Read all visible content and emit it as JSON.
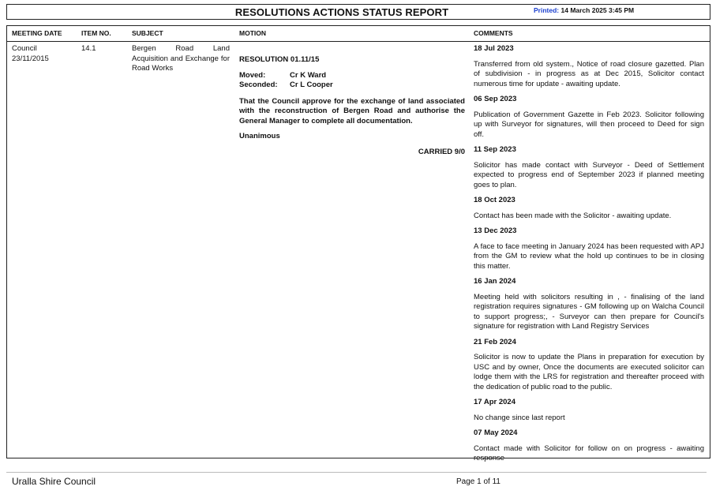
{
  "header": {
    "title": "RESOLUTIONS ACTIONS STATUS REPORT",
    "printed_label": "Printed:",
    "printed_value": "14 March 2025 3:45 PM"
  },
  "columns": {
    "meeting_date": "MEETING DATE",
    "item_no": "ITEM NO.",
    "subject": "SUBJECT",
    "motion": "MOTION",
    "comments": "COMMENTS"
  },
  "row": {
    "meeting": "Council",
    "date": "23/11/2015",
    "item_no": "14.1",
    "subject": "Bergen Road Land Acquisition and Exchange for Road Works",
    "motion": {
      "resolution": "RESOLUTION 01.11/15",
      "moved_label": "Moved:",
      "moved_value": "Cr K Ward",
      "seconded_label": "Seconded:",
      "seconded_value": "Cr L Cooper",
      "text": "That the Council approve for the exchange of land associated with the reconstruction of Bergen Road and authorise the General Manager to complete all documentation.",
      "vote": "Unanimous",
      "result": "CARRIED 9/0"
    },
    "comments": [
      {
        "date": "18 Jul 2023",
        "text": "Transferred from old system., Notice of road closure gazetted.  Plan of subdivision - in progress as at Dec 2015, Solicitor contact numerous time for update - awaiting update."
      },
      {
        "date": "06 Sep 2023",
        "text": "Publication of Government Gazette in Feb 2023. Solicitor following up with Surveyor for signatures, will then proceed to Deed for sign off."
      },
      {
        "date": "11 Sep 2023",
        "text": "Solicitor has made contact with Surveyor  - Deed of Settlement expected to progress end of September 2023 if planned meeting goes to plan."
      },
      {
        "date": "18 Oct 2023",
        "text": "Contact has been made with the Solicitor - awaiting update."
      },
      {
        "date": "13 Dec 2023",
        "text": "A face to face meeting in January 2024  has been requested with APJ from the GM to review what the hold up continues to be in closing this matter."
      },
      {
        "date": "16 Jan 2024",
        "text": "Meeting held with solicitors resulting in , - finalising of the land registration requires signatures - GM following up on Walcha Council to support progress;, - Surveyor can then prepare for Council's signature for registration with Land Registry Services"
      },
      {
        "date": "21 Feb 2024",
        "text": "Solicitor is now to update the Plans in preparation for execution by USC and by owner, Once the documents are executed solicitor can lodge them with the LRS for registration and thereafter proceed with the dedication of public road to the public."
      },
      {
        "date": "17 Apr 2024",
        "text": "No change since last report"
      },
      {
        "date": "07 May 2024",
        "text": "Contact made with Solicitor for follow on on progress - awaiting response"
      }
    ]
  },
  "footer": {
    "organisation": "Uralla Shire Council",
    "page": "Page 1 of 11"
  }
}
